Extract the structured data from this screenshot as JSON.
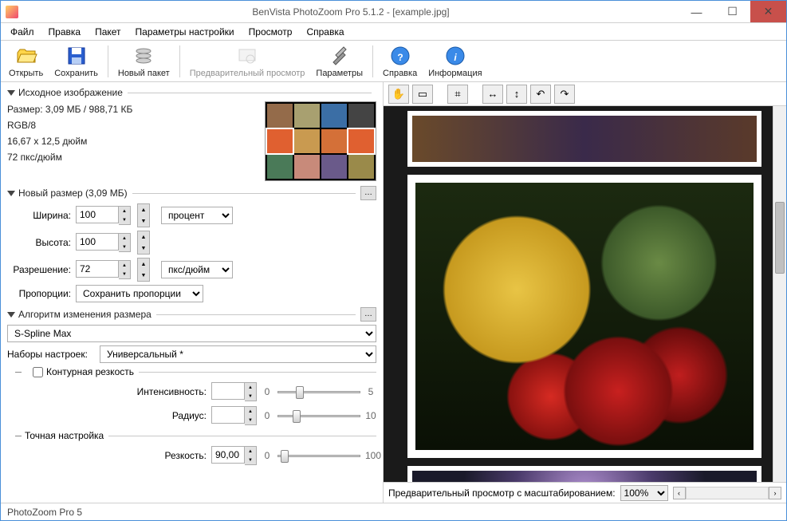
{
  "window": {
    "title": "BenVista PhotoZoom Pro 5.1.2 - [example.jpg]"
  },
  "menu": {
    "file": "Файл",
    "edit": "Правка",
    "batch": "Пакет",
    "settings": "Параметры настройки",
    "view": "Просмотр",
    "help": "Справка"
  },
  "toolbar": {
    "open": "Открыть",
    "save": "Сохранить",
    "newbatch": "Новый пакет",
    "preview": "Предварительный просмотр",
    "params": "Параметры",
    "help": "Справка",
    "info": "Информация"
  },
  "source": {
    "heading": "Исходное изображение",
    "size": "Размер: 3,09 МБ / 988,71 КБ",
    "mode": "RGB/8",
    "dims": "16,67 x 12,5 дюйм",
    "dpi": "72 пкс/дюйм"
  },
  "newsize": {
    "heading": "Новый размер (3,09 МБ)",
    "width_label": "Ширина:",
    "width": "100",
    "height_label": "Высота:",
    "height": "100",
    "unit": "процент",
    "res_label": "Разрешение:",
    "res": "72",
    "res_unit": "пкс/дюйм",
    "aspect_label": "Пропорции:",
    "aspect": "Сохранить пропорции"
  },
  "algo": {
    "heading": "Алгоритм изменения размера",
    "method": "S-Spline Max",
    "presets_label": "Наборы настроек:",
    "preset": "Универсальный *",
    "contour_label": "Контурная резкость",
    "intensity_label": "Интенсивность:",
    "intensity_min": "0",
    "intensity_max": "5",
    "radius_label": "Радиус:",
    "radius_min": "0",
    "radius_max": "10",
    "fine_label": "Точная настройка",
    "sharp_label": "Резкость:",
    "sharp": "90,00",
    "sharp_min": "0",
    "sharp_max": "100"
  },
  "preview": {
    "zoom_label": "Предварительный просмотр с масштабированием:",
    "zoom": "100%"
  },
  "status": "PhotoZoom Pro 5"
}
